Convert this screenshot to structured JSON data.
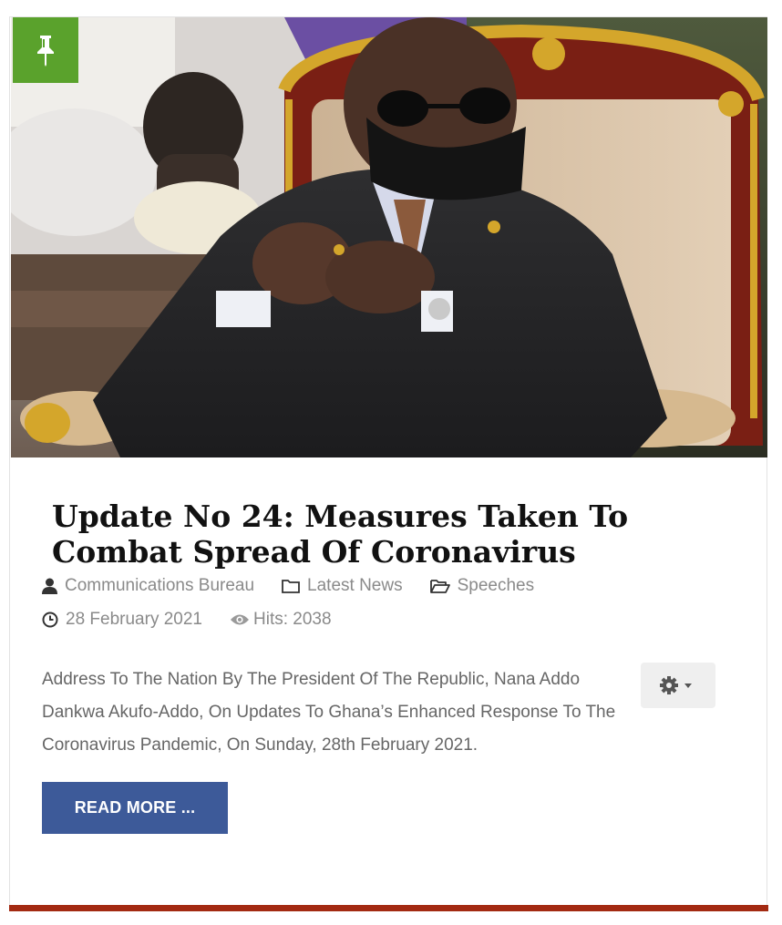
{
  "article": {
    "title": "Update No 24: Measures Taken To Combat Spread Of Coronavirus",
    "author": "Communications Bureau",
    "category": "Latest News",
    "parent_category": "Speeches",
    "date": "28 February 2021",
    "hits": "Hits: 2038",
    "intro": "Address To The Nation By The President Of The Republic, Nana Addo Dankwa Akufo-Addo, On Updates To Ghana’s Enhanced Response To The Coronavirus Pandemic, On Sunday, 28th February 2021.",
    "read_more_label": "READ MORE ..."
  },
  "icons": {
    "featured": "pushpin-icon",
    "author": "user-icon",
    "category": "folder-icon",
    "parent_category": "folder-open-icon",
    "date": "clock-icon",
    "hits": "eye-icon",
    "tools": "gear-icon"
  },
  "colors": {
    "featured_badge": "#5aa22c",
    "read_more": "#3d5a99",
    "bottom_bar": "#a32a12",
    "meta_text": "#8a8a8a"
  }
}
